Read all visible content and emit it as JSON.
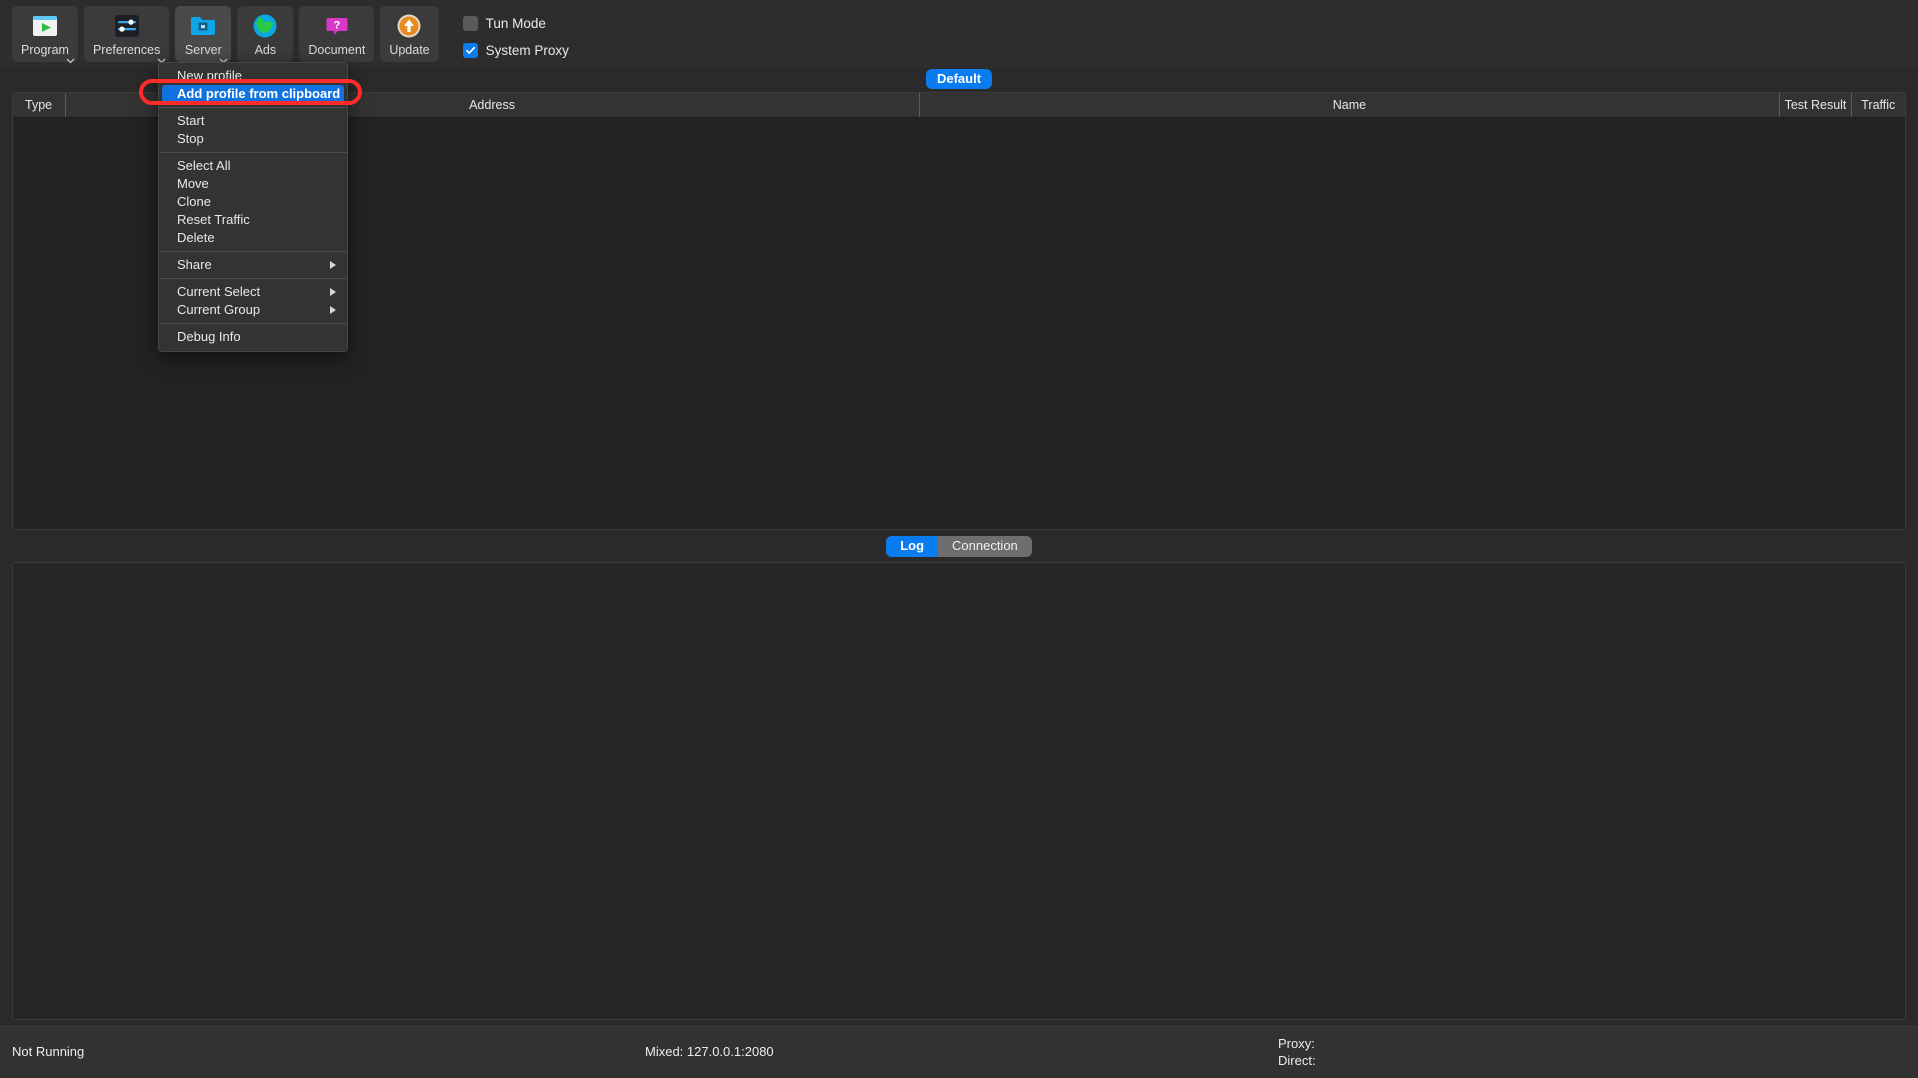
{
  "toolbar": {
    "buttons": [
      {
        "label": "Program",
        "icon": "program-icon",
        "caret": true,
        "active": false
      },
      {
        "label": "Preferences",
        "icon": "preferences-icon",
        "caret": true,
        "active": false
      },
      {
        "label": "Server",
        "icon": "server-icon",
        "caret": true,
        "active": true
      },
      {
        "label": "Ads",
        "icon": "ads-globe-icon",
        "caret": false,
        "active": false
      },
      {
        "label": "Document",
        "icon": "document-icon",
        "caret": false,
        "active": false
      },
      {
        "label": "Update",
        "icon": "update-icon",
        "caret": false,
        "active": false
      }
    ],
    "checkboxes": [
      {
        "label": "Tun Mode",
        "checked": false
      },
      {
        "label": "System Proxy",
        "checked": true
      }
    ]
  },
  "group_tab": {
    "label": "Default",
    "accent": "#0a7cf0"
  },
  "server_table": {
    "columns": [
      {
        "key": "type",
        "label": "Type"
      },
      {
        "key": "address",
        "label": "Address"
      },
      {
        "key": "name",
        "label": "Name"
      },
      {
        "key": "test",
        "label": "Test Result"
      },
      {
        "key": "traffic",
        "label": "Traffic"
      }
    ],
    "rows": []
  },
  "panel_tabs": {
    "items": [
      {
        "label": "Log",
        "selected": true
      },
      {
        "label": "Connection",
        "selected": false
      }
    ]
  },
  "log_pane": {
    "content": ""
  },
  "status_bar": {
    "status": "Not Running",
    "mixed": "Mixed: 127.0.0.1:2080",
    "proxy": "Proxy:",
    "direct": "Direct:"
  },
  "context_menu": {
    "items": [
      {
        "label": "New profile",
        "highlighted": false,
        "submenu": false,
        "separator_after": false
      },
      {
        "label": "Add profile from clipboard",
        "highlighted": true,
        "submenu": false,
        "separator_after": true
      },
      {
        "label": "Start",
        "highlighted": false,
        "submenu": false,
        "separator_after": false
      },
      {
        "label": "Stop",
        "highlighted": false,
        "submenu": false,
        "separator_after": true
      },
      {
        "label": "Select All",
        "highlighted": false,
        "submenu": false,
        "separator_after": false
      },
      {
        "label": "Move",
        "highlighted": false,
        "submenu": false,
        "separator_after": false
      },
      {
        "label": "Clone",
        "highlighted": false,
        "submenu": false,
        "separator_after": false
      },
      {
        "label": "Reset Traffic",
        "highlighted": false,
        "submenu": false,
        "separator_after": false
      },
      {
        "label": "Delete",
        "highlighted": false,
        "submenu": false,
        "separator_after": true
      },
      {
        "label": "Share",
        "highlighted": false,
        "submenu": true,
        "separator_after": true
      },
      {
        "label": "Current Select",
        "highlighted": false,
        "submenu": true,
        "separator_after": false
      },
      {
        "label": "Current Group",
        "highlighted": false,
        "submenu": true,
        "separator_after": true
      },
      {
        "label": "Debug Info",
        "highlighted": false,
        "submenu": false,
        "separator_after": false
      }
    ]
  },
  "annotation": {
    "color": "#ff2b2b",
    "target": "Add profile from clipboard"
  }
}
